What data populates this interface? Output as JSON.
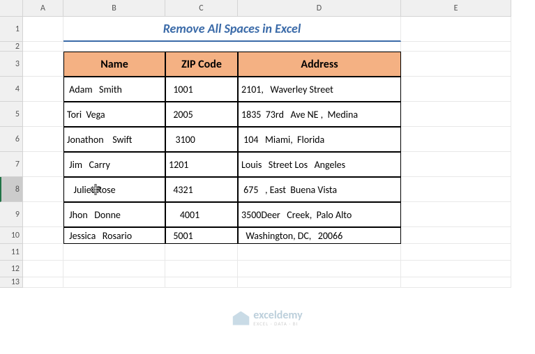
{
  "title": "Remove All Spaces in Excel",
  "columns": [
    "A",
    "B",
    "C",
    "D",
    "E"
  ],
  "rows": [
    "1",
    "2",
    "3",
    "4",
    "5",
    "6",
    "7",
    "8",
    "9",
    "10",
    "11",
    "12",
    "13"
  ],
  "selectedRow": "8",
  "headers": {
    "name": "Name",
    "zip": "ZIP Code",
    "address": "Address"
  },
  "table": [
    {
      "name": " Adam   Smith",
      "zip": "  1001",
      "address": "2101,   Waverley Street"
    },
    {
      "name": "Tori  Vega",
      "zip": "  2005",
      "address": "1835  73rd   Ave NE ,  Medina"
    },
    {
      "name": "Jonathon    Swift",
      "zip": "   3100",
      "address": " 104   Miami,  Florida"
    },
    {
      "name": " Jim   Carry",
      "zip": "1201",
      "address": "Louis   Street Los   Angeles"
    },
    {
      "name": "   Juliet Rose",
      "zip": "  4321",
      "address": " 675   , East  Buena Vista"
    },
    {
      "name": " Jhon   Donne",
      "zip": "     4001",
      "address": "3500Deer   Creek,  Palo Alto"
    },
    {
      "name": " Jessica   Rosario",
      "zip": "  5001",
      "address": "  Washington, DC,   20066"
    }
  ],
  "watermark": {
    "main": "exceldemy",
    "sub": "EXCEL · DATA · BI"
  },
  "chart_data": {
    "type": "table",
    "title": "Remove All Spaces in Excel",
    "columns": [
      "Name",
      "ZIP Code",
      "Address"
    ],
    "rows": [
      [
        " Adam   Smith",
        "  1001",
        "2101,   Waverley Street"
      ],
      [
        "Tori  Vega",
        "  2005",
        "1835  73rd   Ave NE ,  Medina"
      ],
      [
        "Jonathon    Swift",
        "   3100",
        " 104   Miami,  Florida"
      ],
      [
        " Jim   Carry",
        "1201",
        "Louis   Street Los   Angeles"
      ],
      [
        "   Juliet Rose",
        "  4321",
        " 675   , East  Buena Vista"
      ],
      [
        " Jhon   Donne",
        "     4001",
        "3500Deer   Creek,  Palo Alto"
      ],
      [
        " Jessica   Rosario",
        "  5001",
        "  Washington, DC,   20066"
      ]
    ]
  }
}
